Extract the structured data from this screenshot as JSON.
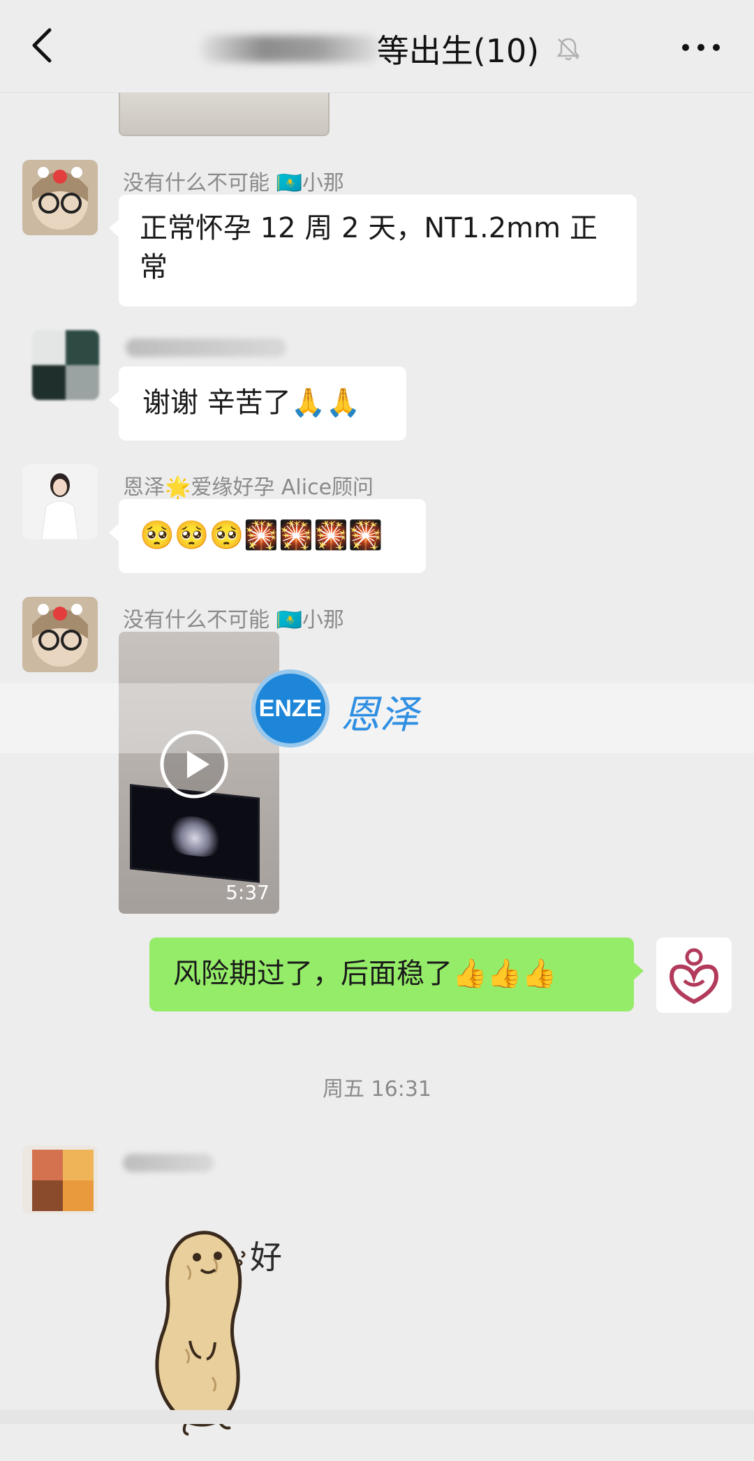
{
  "header": {
    "title": "等出生(10)",
    "back_icon": "chevron-left-icon",
    "mute_icon": "bell-slash-icon",
    "more_icon": "more-dots-icon"
  },
  "messages": [
    {
      "sender": "没有什么不可能 🇰🇿小那",
      "text": "正常怀孕 12 周 2 天，NT1.2mm 正常"
    },
    {
      "sender": "",
      "text": "谢谢 辛苦了🙏🙏"
    },
    {
      "sender": "恩泽🌟爱缘好孕 Alice顾问",
      "text": "🥺🥺🥺🎇🎇🎇🎇"
    },
    {
      "sender": "没有什么不可能 🇰🇿小那",
      "video_duration": "5:37"
    },
    {
      "text": "风险期过了，后面稳了👍👍👍"
    }
  ],
  "watermark": {
    "logo": "ENZE",
    "cn": "恩泽"
  },
  "timestamp": "周五 16:31",
  "sticker": {
    "text": "好"
  },
  "colors": {
    "background": "#ededed",
    "bubble_left": "#ffffff",
    "bubble_right": "#95ec69",
    "meta_text": "#8a8a8a"
  }
}
